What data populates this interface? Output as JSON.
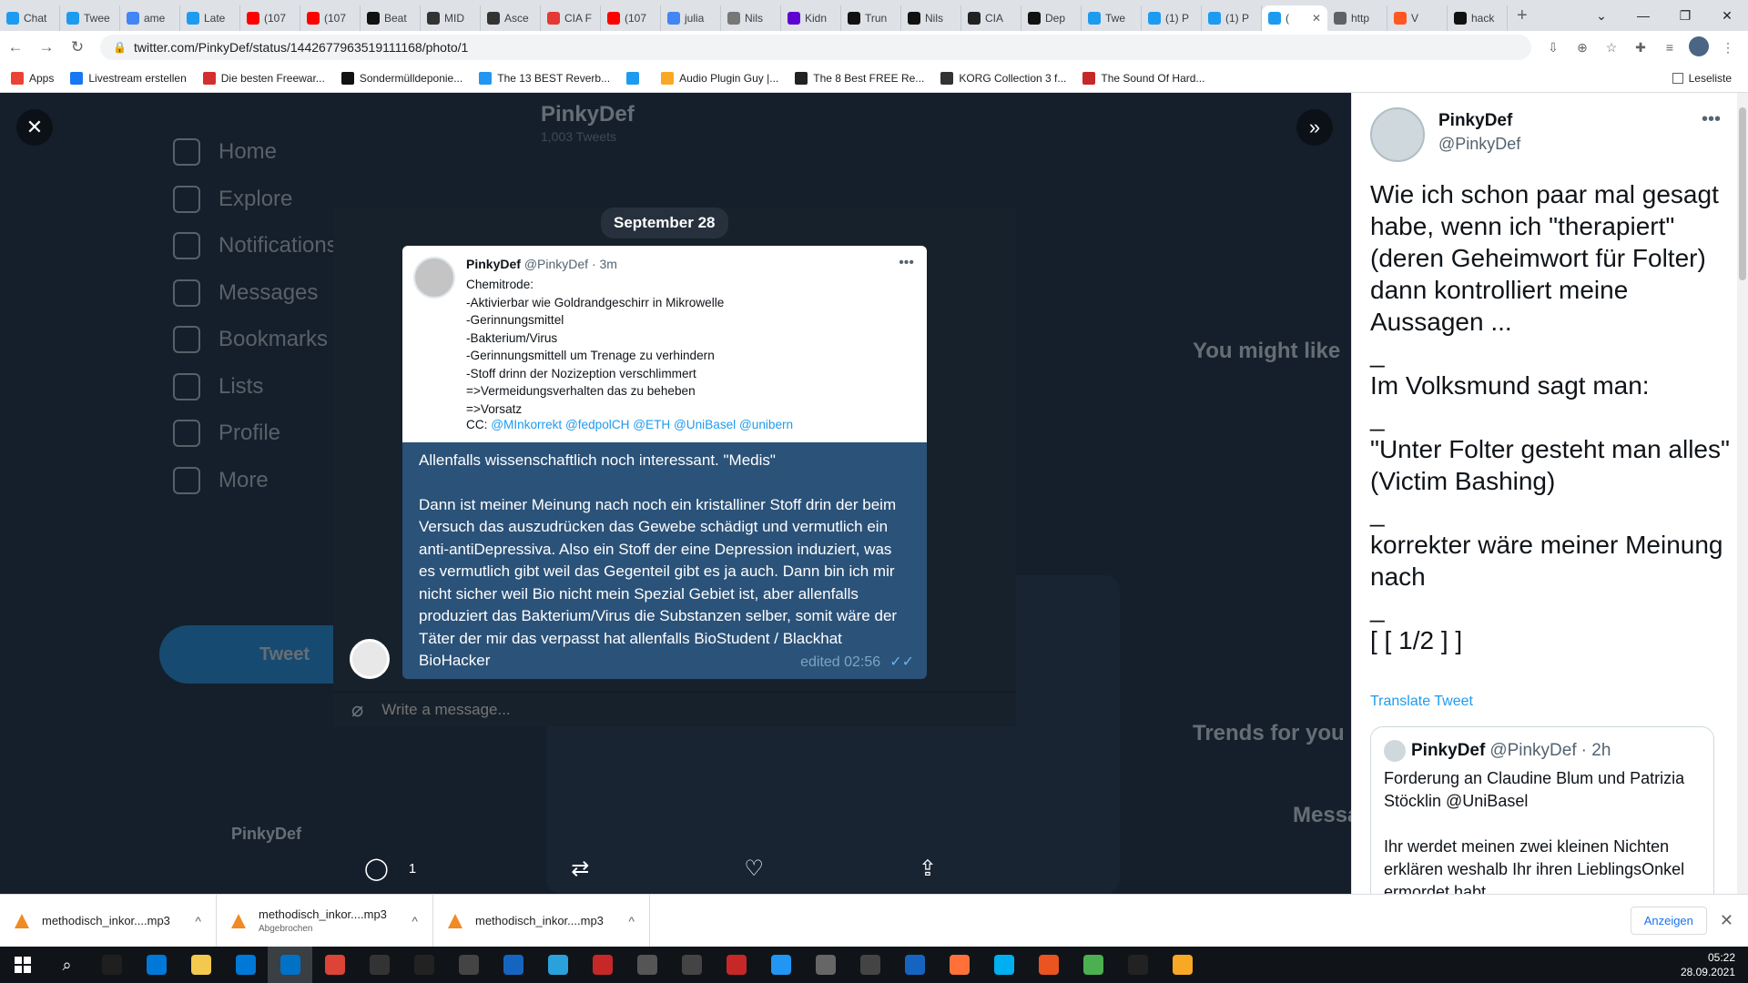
{
  "browser": {
    "tabs": [
      {
        "label": "Chat",
        "color": "#1d9bf0"
      },
      {
        "label": "Twee",
        "color": "#1d9bf0"
      },
      {
        "label": "ame",
        "color": "#4285f4"
      },
      {
        "label": "Late",
        "color": "#1d9bf0"
      },
      {
        "label": "(107",
        "color": "#ff0000"
      },
      {
        "label": "(107",
        "color": "#ff0000"
      },
      {
        "label": "Beat",
        "color": "#111111"
      },
      {
        "label": "MID",
        "color": "#333333"
      },
      {
        "label": "Asce",
        "color": "#333333"
      },
      {
        "label": "CIA F",
        "color": "#e53935"
      },
      {
        "label": "(107",
        "color": "#ff0000"
      },
      {
        "label": "julia",
        "color": "#4285f4"
      },
      {
        "label": "Nils",
        "color": "#777777"
      },
      {
        "label": "Kidn",
        "color": "#6001d2"
      },
      {
        "label": "Trun",
        "color": "#111111"
      },
      {
        "label": "Nils",
        "color": "#111111"
      },
      {
        "label": "CIA",
        "color": "#222222"
      },
      {
        "label": "Dep",
        "color": "#111111"
      },
      {
        "label": "Twe",
        "color": "#1d9bf0"
      },
      {
        "label": "(1) P",
        "color": "#1d9bf0"
      },
      {
        "label": "(1) P",
        "color": "#1d9bf0"
      },
      {
        "label": "(",
        "color": "#1d9bf0",
        "active": true
      },
      {
        "label": "http",
        "color": "#5f6368"
      },
      {
        "label": "V",
        "color": "#ff5722"
      },
      {
        "label": "hack",
        "color": "#111111"
      }
    ],
    "url": "twitter.com/PinkyDef/status/1442677963519111168/photo/1",
    "bookmarks": [
      {
        "label": "Apps",
        "color": "#ea4335"
      },
      {
        "label": "Livestream erstellen",
        "color": "#1877f2"
      },
      {
        "label": "Die besten Freewar...",
        "color": "#d32f2f"
      },
      {
        "label": "Sondermülldeponie...",
        "color": "#111111"
      },
      {
        "label": "The 13 BEST Reverb...",
        "color": "#2196f3"
      },
      {
        "label": "",
        "color": "#1d9bf0"
      },
      {
        "label": "Audio Plugin Guy |...",
        "color": "#f9a825"
      },
      {
        "label": "The 8 Best FREE Re...",
        "color": "#222222"
      },
      {
        "label": "KORG Collection 3 f...",
        "color": "#333333"
      },
      {
        "label": "The Sound Of Hard...",
        "color": "#c62828"
      }
    ],
    "reading_list": "Leseliste"
  },
  "background": {
    "nav": [
      "Home",
      "Explore",
      "Notifications",
      "Messages",
      "Bookmarks",
      "Lists",
      "Profile",
      "More"
    ],
    "tweet_btn": "Tweet",
    "profile_name": "PinkyDef",
    "profile_title": "PinkyDef",
    "profile_sub": "1,003 Tweets",
    "you_might_like": "You might like",
    "trends": "Trends for you",
    "messages": "Messages"
  },
  "photo": {
    "date": "September 28",
    "card": {
      "name": "PinkyDef",
      "handle": "@PinkyDef",
      "time": "· 3m",
      "lines": [
        "Chemitrode:",
        "-Aktivierbar wie Goldrandgeschirr in Mikrowelle",
        "-Gerinnungsmittel",
        "-Bakterium/Virus",
        "-Gerinnungsmittell um Trenage zu verhindern",
        "-Stoff drinn der Nozizeption verschlimmert",
        "=>Vermeidungsverhalten das zu beheben",
        "=>Vorsatz"
      ],
      "cc_label": "CC:",
      "cc_links": "@MInkorrekt @fedpolCH @ETH @UniBasel @unibern"
    },
    "message_first": "Allenfalls wissenschaftlich noch interessant. \"Medis\"",
    "message_body": "Dann ist meiner Meinung nach noch ein kristalliner Stoff drin der beim Versuch das auszudrücken das Gewebe schädigt und vermutlich ein anti-antiDepressiva. Also ein Stoff der eine Depression induziert, was es vermutlich gibt weil das Gegenteil gibt es ja auch. Dann bin ich mir nicht sicher weil Bio nicht mein Spezial Gebiet ist, aber allenfalls produziert das Bakterium/Virus die Substanzen selber, somit wäre der Täter der mir das verpasst hat allenfalls BioStudent / Blackhat BioHacker",
    "edited": "edited 02:56",
    "compose_placeholder": "Write a message..."
  },
  "actions": {
    "reply_count": "1"
  },
  "tweet": {
    "name": "PinkyDef",
    "handle": "@PinkyDef",
    "text": "Wie ich schon paar mal gesagt habe, wenn ich \"therapiert\" (deren Geheimwort für Folter) dann kontrolliert meine Aussagen ...\n_\nIm Volksmund sagt man:\n_\n\"Unter Folter gesteht man alles\" (Victim Bashing)\n_\nkorrekter wäre meiner Meinung nach\n_\n[ [ 1/2 ] ]",
    "translate": "Translate Tweet",
    "quote": {
      "name": "PinkyDef",
      "handle": "@PinkyDef",
      "time": "· 2h",
      "text": "Forderung an Claudine Blum und Patrizia Stöcklin @UniBasel\n\nIhr werdet meinen zwei kleinen Nichten erklären weshalb Ihr ihren LieblingsOnkel ermordet habt"
    }
  },
  "downloads": {
    "items": [
      {
        "name": "methodisch_inkor....mp3",
        "status": ""
      },
      {
        "name": "methodisch_inkor....mp3",
        "status": "Abgebrochen"
      },
      {
        "name": "methodisch_inkor....mp3",
        "status": ""
      }
    ],
    "show_all": "Anzeigen"
  },
  "taskbar": {
    "icons": [
      "#1f1f1f",
      "#0078d7",
      "#f2c94c",
      "#0078d7",
      "#0072c6",
      "#db4437",
      "#333333",
      "#222222",
      "#444444",
      "#1565c0",
      "#2aa1da",
      "#c62828",
      "#555555",
      "#444444",
      "#c62828",
      "#2196f3",
      "#666666",
      "#444444",
      "#1565c0",
      "#ff7139",
      "#00aff0",
      "#e95420",
      "#4caf50",
      "#222222",
      "#f9a825"
    ],
    "time": "05:22",
    "date": "28.09.2021"
  }
}
